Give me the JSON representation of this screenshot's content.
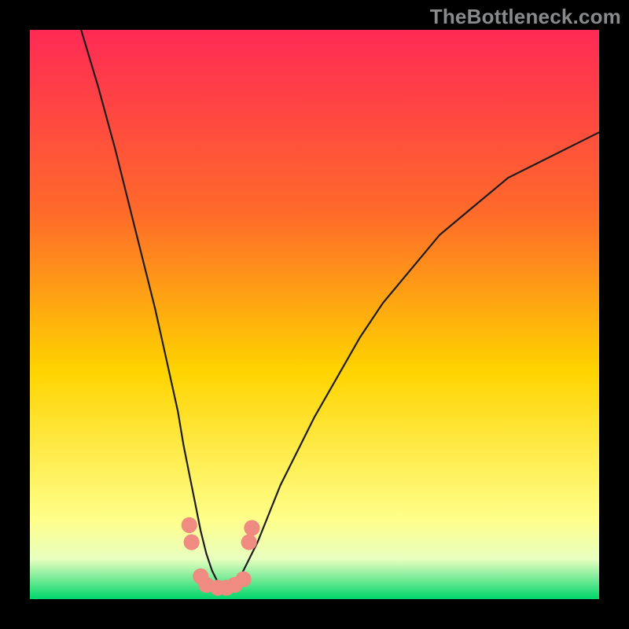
{
  "watermark": "TheBottleneck.com",
  "colors": {
    "gradient_top": "#ff2a55",
    "gradient_mid1": "#ff6a2a",
    "gradient_mid2": "#ffd400",
    "gradient_mid3": "#ffff8a",
    "gradient_bottom": "#00d66b",
    "frame": "#000000",
    "curve": "#1c1c1c",
    "marker": "#ef8b80"
  },
  "chart_data": {
    "type": "line",
    "title": "",
    "xlabel": "",
    "ylabel": "",
    "xlim": [
      0,
      100
    ],
    "ylim": [
      0,
      100
    ],
    "grid": false,
    "notes": "V-shaped bottleneck curve. x is relative position across the horizontal extent (0–100), y is vertical value (0 at bottom, 100 at top). Bottom ~8% of the gradient is green; markers lie near the valley floor.",
    "series": [
      {
        "name": "curve",
        "x": [
          9,
          12,
          15,
          18,
          20,
          22,
          24,
          26,
          27,
          28,
          29,
          30,
          31,
          32,
          33,
          34,
          35,
          36,
          37,
          38,
          40,
          42,
          44,
          47,
          50,
          54,
          58,
          62,
          67,
          72,
          78,
          84,
          90,
          96,
          100
        ],
        "values": [
          100,
          90,
          79,
          67,
          59,
          51,
          42,
          33,
          27,
          22,
          17,
          12,
          8,
          5,
          3,
          2,
          2,
          3,
          4,
          6,
          10,
          15,
          20,
          26,
          32,
          39,
          46,
          52,
          58,
          64,
          69,
          74,
          77,
          80,
          82
        ]
      }
    ],
    "markers": {
      "name": "valley-points",
      "shape": "circle",
      "radius_pct": 1.4,
      "points": [
        {
          "x": 28.0,
          "y": 13.0
        },
        {
          "x": 28.4,
          "y": 10.0
        },
        {
          "x": 30.0,
          "y": 4.0
        },
        {
          "x": 31.0,
          "y": 2.5
        },
        {
          "x": 33.0,
          "y": 2.0
        },
        {
          "x": 34.5,
          "y": 2.0
        },
        {
          "x": 36.0,
          "y": 2.5
        },
        {
          "x": 37.5,
          "y": 3.5
        },
        {
          "x": 38.5,
          "y": 10.0
        },
        {
          "x": 39.0,
          "y": 12.5
        }
      ]
    }
  }
}
